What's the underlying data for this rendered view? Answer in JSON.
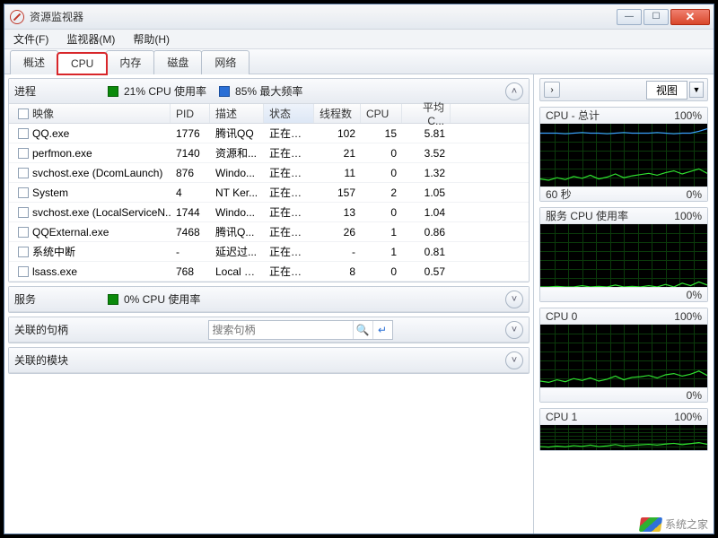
{
  "window": {
    "title": "资源监视器"
  },
  "menu": {
    "file": "文件(F)",
    "monitor": "监视器(M)",
    "help": "帮助(H)"
  },
  "tabs": {
    "overview": "概述",
    "cpu": "CPU",
    "memory": "内存",
    "disk": "磁盘",
    "network": "网络",
    "active": "cpu"
  },
  "sections": {
    "processes": {
      "title": "进程",
      "cpu_usage": "21% CPU 使用率",
      "max_freq": "85% 最大频率",
      "columns": {
        "image": "映像",
        "pid": "PID",
        "desc": "描述",
        "status": "状态",
        "threads": "线程数",
        "cpu": "CPU",
        "avg": "平均 C..."
      },
      "rows": [
        {
          "image": "QQ.exe",
          "pid": "1776",
          "desc": "腾讯QQ",
          "status": "正在运行",
          "threads": "102",
          "cpu": "15",
          "avg": "5.81"
        },
        {
          "image": "perfmon.exe",
          "pid": "7140",
          "desc": "资源和...",
          "status": "正在运行",
          "threads": "21",
          "cpu": "0",
          "avg": "3.52"
        },
        {
          "image": "svchost.exe (DcomLaunch)",
          "pid": "876",
          "desc": "Windo...",
          "status": "正在运行",
          "threads": "11",
          "cpu": "0",
          "avg": "1.32"
        },
        {
          "image": "System",
          "pid": "4",
          "desc": "NT Ker...",
          "status": "正在运行",
          "threads": "157",
          "cpu": "2",
          "avg": "1.05"
        },
        {
          "image": "svchost.exe (LocalServiceN...",
          "pid": "1744",
          "desc": "Windo...",
          "status": "正在运行",
          "threads": "13",
          "cpu": "0",
          "avg": "1.04"
        },
        {
          "image": "QQExternal.exe",
          "pid": "7468",
          "desc": "腾讯Q...",
          "status": "正在运行",
          "threads": "26",
          "cpu": "1",
          "avg": "0.86"
        },
        {
          "image": "系统中断",
          "pid": "-",
          "desc": "延迟过...",
          "status": "正在运行",
          "threads": "-",
          "cpu": "1",
          "avg": "0.81"
        },
        {
          "image": "lsass.exe",
          "pid": "768",
          "desc": "Local S...",
          "status": "正在运行",
          "threads": "8",
          "cpu": "0",
          "avg": "0.57"
        }
      ]
    },
    "services": {
      "title": "服务",
      "cpu_usage": "0% CPU 使用率"
    },
    "handles": {
      "title": "关联的句柄",
      "search_placeholder": "搜索句柄"
    },
    "modules": {
      "title": "关联的模块"
    }
  },
  "right": {
    "view_label": "视图",
    "graphs": [
      {
        "title_left": "CPU - 总计",
        "title_right": "100%",
        "foot_left": "60 秒",
        "foot_right": "0%",
        "has_foot": true
      },
      {
        "title_left": "服务 CPU 使用率",
        "title_right": "100%",
        "foot_left": "",
        "foot_right": "0%",
        "has_foot": true
      },
      {
        "title_left": "CPU 0",
        "title_right": "100%",
        "foot_left": "",
        "foot_right": "0%",
        "has_foot": true
      },
      {
        "title_left": "CPU 1",
        "title_right": "100%",
        "foot_left": "",
        "foot_right": "",
        "has_foot": false
      }
    ]
  },
  "watermark": "系统之家",
  "chart_data": [
    {
      "type": "line",
      "title": "CPU - 总计",
      "ylim": [
        0,
        100
      ],
      "xlabel": "60 秒",
      "ylabel": "%",
      "series": [
        {
          "name": "CPU 使用率",
          "color": "#2fe02f",
          "values": [
            12,
            10,
            14,
            11,
            16,
            13,
            18,
            12,
            15,
            20,
            14,
            17,
            19,
            21,
            18,
            22,
            25,
            20,
            24,
            28,
            21
          ]
        },
        {
          "name": "最大频率",
          "color": "#3aa0ff",
          "values": [
            85,
            85,
            85,
            84,
            85,
            86,
            85,
            85,
            84,
            85,
            86,
            85,
            85,
            85,
            86,
            85,
            84,
            85,
            85,
            88,
            92
          ]
        }
      ]
    },
    {
      "type": "line",
      "title": "服务 CPU 使用率",
      "ylim": [
        0,
        100
      ],
      "ylabel": "%",
      "series": [
        {
          "name": "使用率",
          "color": "#2fe02f",
          "values": [
            0,
            0,
            1,
            0,
            0,
            2,
            0,
            1,
            0,
            3,
            0,
            1,
            0,
            2,
            0,
            4,
            0,
            6,
            2,
            8,
            3
          ]
        }
      ]
    },
    {
      "type": "line",
      "title": "CPU 0",
      "ylim": [
        0,
        100
      ],
      "ylabel": "%",
      "series": [
        {
          "name": "使用率",
          "color": "#2fe02f",
          "values": [
            10,
            8,
            12,
            9,
            14,
            11,
            15,
            10,
            13,
            18,
            12,
            16,
            17,
            19,
            15,
            20,
            22,
            18,
            21,
            26,
            19
          ]
        }
      ]
    },
    {
      "type": "line",
      "title": "CPU 1",
      "ylim": [
        0,
        100
      ],
      "ylabel": "%",
      "series": [
        {
          "name": "使用率",
          "color": "#2fe02f",
          "values": [
            14,
            12,
            16,
            13,
            18,
            15,
            20,
            14,
            17,
            22,
            16,
            19,
            21,
            23,
            20,
            24,
            27,
            22,
            26,
            30,
            23
          ]
        }
      ]
    }
  ]
}
